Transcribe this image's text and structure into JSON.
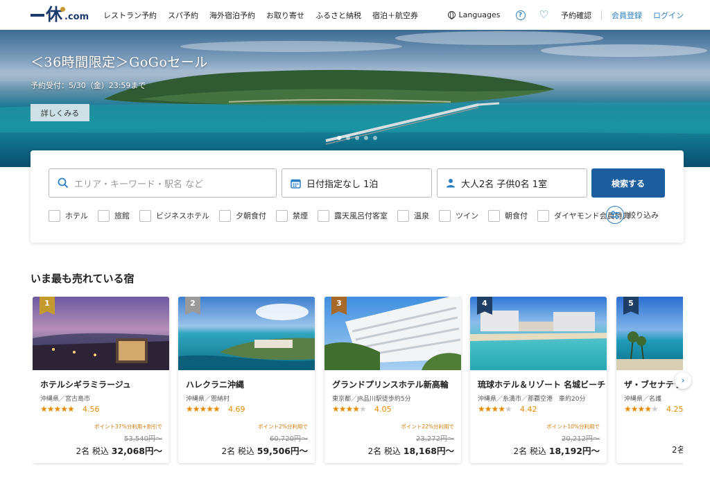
{
  "header": {
    "logo": {
      "com": ".com"
    },
    "nav": [
      "レストラン予約",
      "スパ予約",
      "海外宿泊予約",
      "お取り寄せ",
      "ふるさと納税",
      "宿泊＋航空券"
    ],
    "languages": "Languages",
    "help": "?",
    "reservation_check": "予約確認",
    "member_register": "会員登録",
    "login": "ログイン"
  },
  "hero": {
    "title": "＜36時間限定＞GoGoセール",
    "subtitle": "予約受付：5/30（金）23:59まで",
    "button": "詳しくみる",
    "slide_count": 5,
    "active_slide": 0
  },
  "search": {
    "keyword_placeholder": "エリア・キーワード・駅名 など",
    "date": "日付指定なし 1泊",
    "guests": "大人2名 子供0名 1室",
    "button": "検索する",
    "filters": [
      "ホテル",
      "旅館",
      "ビジネスホテル",
      "夕朝食付",
      "禁煙",
      "露天風呂付客室",
      "温泉",
      "ツイン",
      "朝食付",
      "ダイヤモンド会員特典"
    ],
    "narrow": "絞り込み"
  },
  "ranking": {
    "title": "いま最も売れている宿",
    "cards": [
      {
        "rank": "1",
        "name": "ホテルシギラミラージュ",
        "location": "沖縄県／宮古島市",
        "rating": 4.56,
        "rating_text": "4.56",
        "stars": "★★★★★",
        "promo": "ポイント37%分利用+割引で",
        "original_price": "53,540円〜",
        "price_prefix": "2名 税込 ",
        "price": "32,068円〜",
        "badge_color": "#c49a2c"
      },
      {
        "rank": "2",
        "name": "ハレクラニ沖縄",
        "location": "沖縄県／恩納村",
        "rating": 4.69,
        "rating_text": "4.69",
        "stars": "★★★★★",
        "promo": "ポイント2%分利用で",
        "original_price": "60,720円〜",
        "price_prefix": "2名 税込 ",
        "price": "59,506円〜",
        "badge_color": "#9a9a9a"
      },
      {
        "rank": "3",
        "name": "グランドプリンスホテル新高輪",
        "location": "東京都／JR品川駅徒歩約5分",
        "rating": 4.05,
        "rating_text": "4.05",
        "stars": "★★★★",
        "promo": "ポイント22%分利用で",
        "original_price": "23,272円〜",
        "price_prefix": "2名 税込 ",
        "price": "18,168円〜",
        "badge_color": "#a6692a"
      },
      {
        "rank": "4",
        "name": "琉球ホテル＆リゾート 名城ビーチ",
        "location": "沖縄県／糸満市／那覇空港　車約20分",
        "rating": 4.42,
        "rating_text": "4.42",
        "stars": "★★★★",
        "promo": "ポイント10%分利用で",
        "original_price": "20,212円〜",
        "price_prefix": "2名 税込 ",
        "price": "18,192円〜",
        "badge_color": "#1f3e66"
      },
      {
        "rank": "5",
        "name": "ザ・ブセナテラス",
        "location": "沖縄県／名護",
        "rating": 4.25,
        "rating_text": "4.25",
        "stars": "★★★★",
        "promo": "",
        "original_price": "",
        "price_prefix": "2名",
        "price": "",
        "badge_color": "#1f3e66"
      }
    ],
    "next": "›"
  },
  "colors": {
    "brand_navy": "#1a3a6b",
    "accent_blue": "#2a7fc4",
    "search_button": "#1c5e9e",
    "star_orange": "#e68a00",
    "promo_orange": "#d4780a"
  }
}
